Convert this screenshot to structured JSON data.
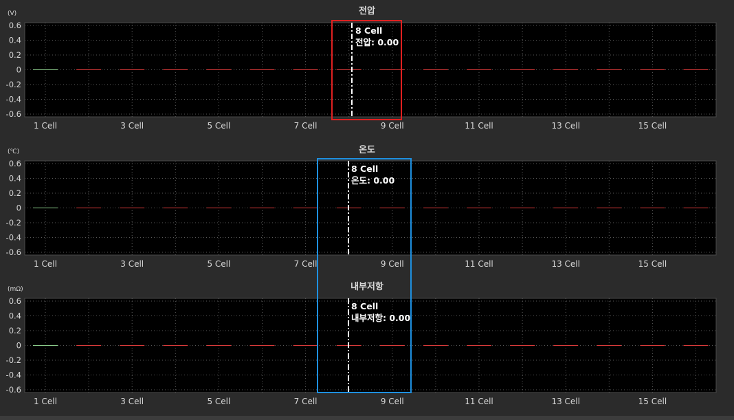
{
  "colors": {
    "background": "#2b2b2b",
    "plot_background": "#000000",
    "plot_border": "#4a4a4a",
    "grid": "#5a5a5a",
    "text": "#d8d8d8",
    "cursor": "#ffffff",
    "series_first": "#8fd18f",
    "series_rest": "#e03c3c",
    "highlight_red": "#e02020",
    "highlight_blue": "#1e90e0"
  },
  "chart_data": [
    {
      "type": "line",
      "title": "전압",
      "unit": "(V)",
      "ylim": [
        -0.6,
        0.6
      ],
      "yticks": [
        "0.6",
        "0.4",
        "0.2",
        "0",
        "-0.2",
        "-0.4",
        "-0.6"
      ],
      "categories": [
        "1 Cell",
        "2 Cell",
        "3 Cell",
        "4 Cell",
        "5 Cell",
        "6 Cell",
        "7 Cell",
        "8 Cell",
        "9 Cell",
        "10 Cell",
        "11 Cell",
        "12 Cell",
        "13 Cell",
        "14 Cell",
        "15 Cell",
        "16 Cell"
      ],
      "xtick_labels": [
        "1 Cell",
        "3 Cell",
        "5 Cell",
        "7 Cell",
        "9 Cell",
        "11 Cell",
        "13 Cell",
        "15 Cell"
      ],
      "values": [
        0,
        0,
        0,
        0,
        0,
        0,
        0,
        0,
        0,
        0,
        0,
        0,
        0,
        0,
        0,
        0
      ],
      "grid": true,
      "cursor": {
        "category": "8 Cell",
        "label": "8 Cell",
        "value_label": "전압: 0.00"
      },
      "highlight": "red"
    },
    {
      "type": "line",
      "title": "온도",
      "unit": "(℃)",
      "ylim": [
        -0.6,
        0.6
      ],
      "yticks": [
        "0.6",
        "0.4",
        "0.2",
        "0",
        "-0.2",
        "-0.4",
        "-0.6"
      ],
      "categories": [
        "1 Cell",
        "2 Cell",
        "3 Cell",
        "4 Cell",
        "5 Cell",
        "6 Cell",
        "7 Cell",
        "8 Cell",
        "9 Cell",
        "10 Cell",
        "11 Cell",
        "12 Cell",
        "13 Cell",
        "14 Cell",
        "15 Cell",
        "16 Cell"
      ],
      "xtick_labels": [
        "1 Cell",
        "3 Cell",
        "5 Cell",
        "7 Cell",
        "9 Cell",
        "11 Cell",
        "13 Cell",
        "15 Cell"
      ],
      "values": [
        0,
        0,
        0,
        0,
        0,
        0,
        0,
        0,
        0,
        0,
        0,
        0,
        0,
        0,
        0,
        0
      ],
      "grid": true,
      "cursor": {
        "category": "8 Cell",
        "label": "8 Cell",
        "value_label": "온도: 0.00"
      },
      "highlight": "blue"
    },
    {
      "type": "line",
      "title": "내부저항",
      "unit": "(mΩ)",
      "ylim": [
        -0.6,
        0.6
      ],
      "yticks": [
        "0.6",
        "0.4",
        "0.2",
        "0",
        "-0.2",
        "-0.4",
        "-0.6"
      ],
      "categories": [
        "1 Cell",
        "2 Cell",
        "3 Cell",
        "4 Cell",
        "5 Cell",
        "6 Cell",
        "7 Cell",
        "8 Cell",
        "9 Cell",
        "10 Cell",
        "11 Cell",
        "12 Cell",
        "13 Cell",
        "14 Cell",
        "15 Cell",
        "16 Cell"
      ],
      "xtick_labels": [
        "1 Cell",
        "3 Cell",
        "5 Cell",
        "7 Cell",
        "9 Cell",
        "11 Cell",
        "13 Cell",
        "15 Cell"
      ],
      "values": [
        0,
        0,
        0,
        0,
        0,
        0,
        0,
        0,
        0,
        0,
        0,
        0,
        0,
        0,
        0,
        0
      ],
      "grid": true,
      "cursor": {
        "category": "8 Cell",
        "label": "8 Cell",
        "value_label": "내부저항: 0.00"
      },
      "highlight": "blue"
    }
  ]
}
